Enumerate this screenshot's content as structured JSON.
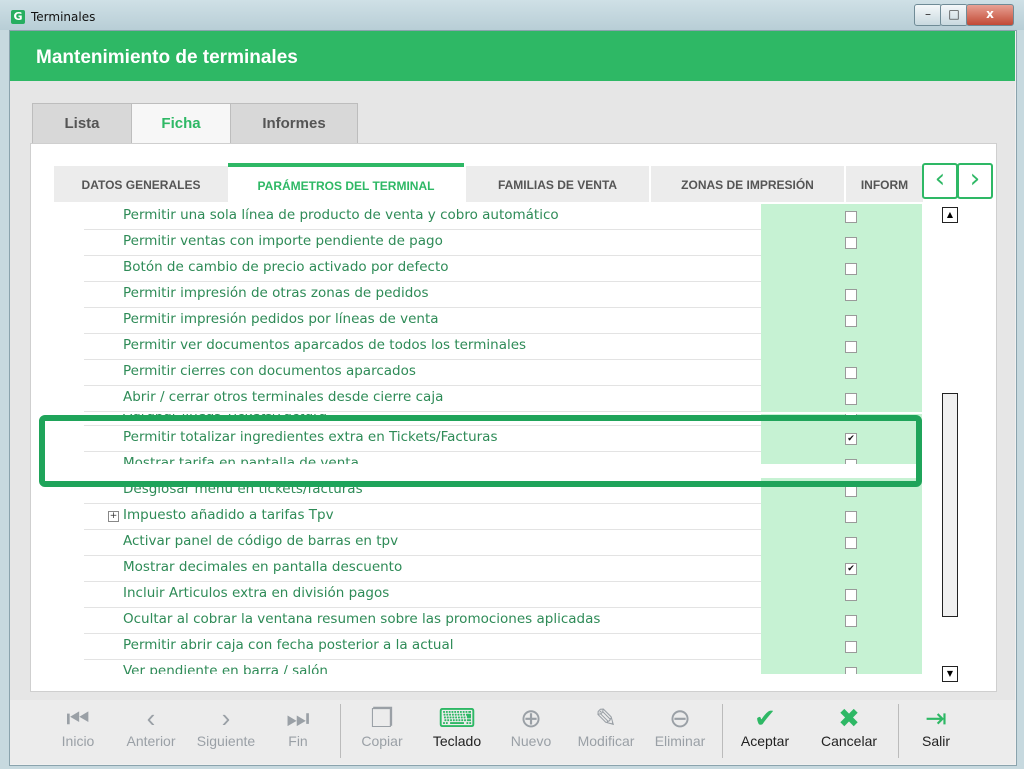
{
  "window": {
    "title": "Terminales",
    "app_icon": "G",
    "minimize": "–",
    "maximize": "□",
    "close": "x"
  },
  "header": {
    "title": "Mantenimiento de terminales"
  },
  "main_tabs": [
    {
      "label": "Lista"
    },
    {
      "label": "Ficha"
    },
    {
      "label": "Informes"
    }
  ],
  "sub_tabs": [
    {
      "label": "DATOS GENERALES"
    },
    {
      "label": "PARÁMETROS DEL TERMINAL"
    },
    {
      "label": "FAMILIAS DE VENTA"
    },
    {
      "label": "ZONAS DE IMPRESIÓN"
    },
    {
      "label": "INFORM"
    }
  ],
  "nav": {
    "prev": "‹",
    "next": "›"
  },
  "rows": [
    {
      "label": "Permitir una sola línea de producto de venta y cobro automático",
      "check": ""
    },
    {
      "label": "Permitir ventas con importe pendiente de pago",
      "check": ""
    },
    {
      "label": "Botón de cambio de precio activado por defecto",
      "check": ""
    },
    {
      "label": "Permitir impresión de otras zonas de pedidos",
      "check": ""
    },
    {
      "label": "Permitir impresión pedidos por líneas de venta",
      "check": ""
    },
    {
      "label": "Permitir ver documentos aparcados de todos los terminales",
      "check": ""
    },
    {
      "label": "Permitir cierres con documentos aparcados",
      "check": ""
    },
    {
      "label": "Abrir / cerrar otros terminales desde cierre caja",
      "check": ""
    },
    {
      "label": "Agrupar líneas Tickets/Factura",
      "check": ""
    },
    {
      "label": "Permitir totalizar ingredientes extra en Tickets/Facturas",
      "check": "✔"
    },
    {
      "label": "Mostrar tarifa en pantalla de venta",
      "check": ""
    },
    {
      "label": "Desglosar menú en tickets/facturas",
      "check": ""
    },
    {
      "label": "Impuesto añadido a tarifas Tpv",
      "check": "",
      "expander": "+"
    },
    {
      "label": "Activar panel de código de barras en tpv",
      "check": ""
    },
    {
      "label": "Mostrar decimales en pantalla descuento",
      "check": "✔"
    },
    {
      "label": "Incluir Articulos extra en división pagos",
      "check": ""
    },
    {
      "label": "Ocultar al cobrar la ventana resumen sobre las promociones aplicadas",
      "check": ""
    },
    {
      "label": "Permitir abrir caja con fecha posterior a la actual",
      "check": ""
    },
    {
      "label": "Ver pendiente en barra / salón",
      "check": ""
    }
  ],
  "scroll": {
    "up": "▲",
    "down": "▼"
  },
  "toolbar": {
    "inicio": "Inicio",
    "anterior": "Anterior",
    "siguiente": "Siguiente",
    "fin": "Fin",
    "copiar": "Copiar",
    "teclado": "Teclado",
    "nuevo": "Nuevo",
    "modificar": "Modificar",
    "eliminar": "Eliminar",
    "aceptar": "Aceptar",
    "cancelar": "Cancelar",
    "salir": "Salir"
  },
  "colors": {
    "accent": "#2eb865",
    "cell": "#c6f2d3",
    "label": "#2e8b57"
  }
}
